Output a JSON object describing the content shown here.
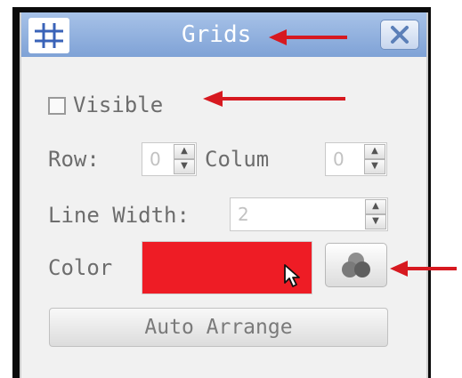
{
  "dialog": {
    "title": "Grids",
    "icons": {
      "title": "grid-icon",
      "close": "close-icon",
      "palette": "color-palette-icon",
      "cursor": "mouse-cursor-icon"
    }
  },
  "visible": {
    "label": "Visible",
    "checked": false
  },
  "row": {
    "label": "Row:",
    "value": "0"
  },
  "column": {
    "label": "Colum",
    "value": "0"
  },
  "line_width": {
    "label": "Line Width:",
    "value": "2"
  },
  "color": {
    "label": "Color",
    "value": "#ee1c25"
  },
  "auto_arrange": {
    "label": "Auto Arrange"
  },
  "annotations": {
    "arrow_color": "#d71920"
  }
}
